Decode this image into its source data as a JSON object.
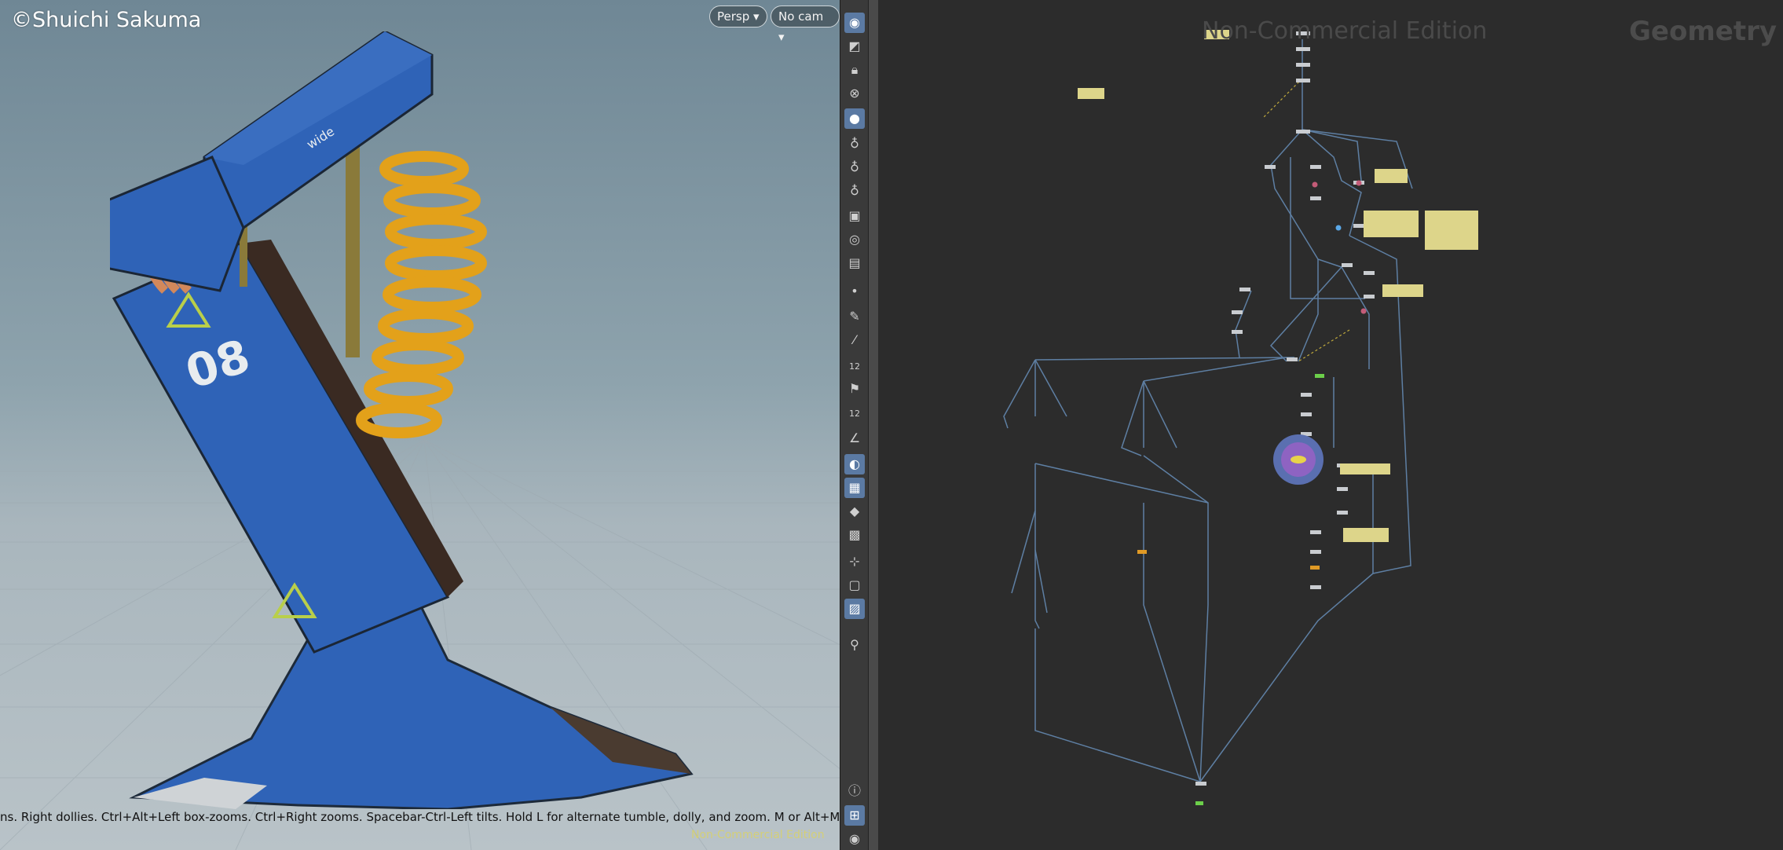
{
  "viewport": {
    "credit": "©Shuichi Sakuma",
    "camera_menu": "Persp",
    "camera_select": "No cam",
    "hint": "ns. Right dollies. Ctrl+Alt+Left box-zooms. Ctrl+Right zooms. Spacebar-Ctrl-Left tilts. Hold L for alternate tumble, dolly, and zoom.      M or Alt+M",
    "watermark": "Non-Commercial Edition",
    "model_text": {
      "number": "08",
      "label": "wide"
    }
  },
  "toolbar": {
    "top": [
      "eye-icon",
      "select-icon",
      "lock-icon",
      "close-circle-icon",
      "sphere-icon",
      "bulb-icon",
      "bulb2-icon",
      "bulb3-icon",
      "camera-icon",
      "eye2-icon",
      "render-icon",
      "dot-icon",
      "pen-icon",
      "brush-icon",
      "ruler12-icon",
      "flag-icon",
      "ruler12b-icon",
      "angle-icon",
      "sphere2-icon",
      "checker-icon",
      "cube-icon",
      "uv-icon",
      "axis-icon",
      "grid-icon",
      "image-icon",
      "pin-icon"
    ],
    "bottom": [
      "info-icon",
      "layout-icon",
      "view-icon"
    ],
    "ruler_label": "12"
  },
  "network": {
    "watermark": "Non-Commercial Edition",
    "context_label": "Geometry"
  },
  "colors": {
    "viewport_top": "#6f8795",
    "viewport_bottom": "#b9c3c8",
    "network_bg": "#2c2c2c",
    "node": "#c9ccd0",
    "wire": "#5e7fa3",
    "sticky": "#ddd58a",
    "accent_blue": "#2f6bc2",
    "spring_yellow": "#e3a11a"
  }
}
